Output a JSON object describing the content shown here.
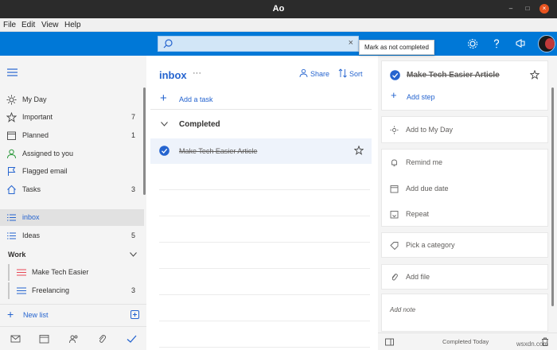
{
  "window": {
    "title": "Ao",
    "min": "–",
    "max": "□",
    "close": "×"
  },
  "menu": [
    "File",
    "Edit",
    "View",
    "Help"
  ],
  "search": {
    "placeholder": "",
    "clear": "×"
  },
  "tooltip": "Mark as not completed",
  "sidebar": {
    "items": [
      {
        "label": "My Day",
        "count": "",
        "icon": "sun-icon"
      },
      {
        "label": "Important",
        "count": "7",
        "icon": "star-icon"
      },
      {
        "label": "Planned",
        "count": "1",
        "icon": "calendar-icon"
      },
      {
        "label": "Assigned to you",
        "count": "",
        "icon": "person-icon"
      },
      {
        "label": "Flagged email",
        "count": "",
        "icon": "flag-icon"
      },
      {
        "label": "Tasks",
        "count": "3",
        "icon": "home-icon"
      },
      {
        "label": "inbox",
        "count": "",
        "icon": "list-icon"
      },
      {
        "label": "Ideas",
        "count": "5",
        "icon": "list-icon"
      }
    ],
    "group": "Work",
    "group_items": [
      {
        "label": "Make Tech Easier",
        "count": "",
        "color": "#e74856"
      },
      {
        "label": "Freelancing",
        "count": "3",
        "color": "#2564cf"
      }
    ],
    "new_list": "New list"
  },
  "main": {
    "title": "inbox",
    "more": "···",
    "share": "Share",
    "sort": "Sort",
    "add_task": "Add a task",
    "completed": "Completed",
    "task": "Make Tech Easier Article"
  },
  "detail": {
    "title": "Make Tech Easier Article",
    "add_step": "Add step",
    "add_to_my_day": "Add to My Day",
    "remind_me": "Remind me",
    "add_due_date": "Add due date",
    "repeat": "Repeat",
    "category": "Pick a category",
    "add_file": "Add file",
    "add_note": "Add note",
    "footer": "Completed Today"
  },
  "watermark": "wsxdn.com",
  "colors": {
    "accent": "#0078d7",
    "link": "#2564cf",
    "sidebar_bg": "#f4f4f4"
  }
}
